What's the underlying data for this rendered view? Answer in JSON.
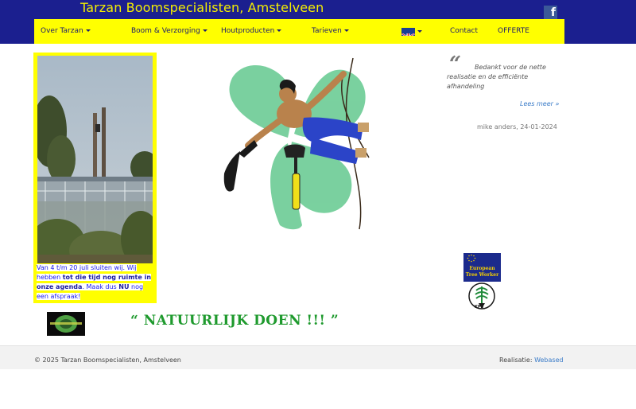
{
  "header": {
    "site_title": "Tarzan Boomspecialisten, Amstelveen",
    "background_color": "#1b1f8f",
    "title_color": "#f4ee00"
  },
  "nav": {
    "background_color": "#ffff00",
    "items": [
      {
        "label": "Over Tarzan",
        "dropdown": true
      },
      {
        "label": "Boom & Verzorging",
        "dropdown": true
      },
      {
        "label": "Houtproducten",
        "dropdown": true
      },
      {
        "label": "Tarieven",
        "dropdown": true
      },
      {
        "label": "Contact",
        "dropdown": false
      },
      {
        "label": "OFFERTE",
        "dropdown": false
      }
    ],
    "language_icon": "uk-flag-icon",
    "social_icon": "facebook-icon",
    "facebook_glyph": "f"
  },
  "notice": {
    "text_1": "Van 4 t/m 20 juli sluiten wij. Wij hebben ",
    "text_bold_1": "tot die tijd nog ruimte in onze agenda",
    "text_2": ". Maak dus ",
    "text_bold_2": "NU",
    "text_3": " nog een afspraak!"
  },
  "testimonial": {
    "quote_mark": "“",
    "text": "Bedankt voor de nette realisatie en de efficiënte afhandeling",
    "read_more": "Lees meer »",
    "author": "mike anders, 24-01-2024"
  },
  "logos": {
    "etw_text": "European Tree Worker",
    "kpb_text": "KPB"
  },
  "slogan": "“ NATUURLIJK DOEN !!! ”",
  "footer": {
    "copyright": "© 2025 Tarzan Boomspecialisten, Amstelveen",
    "realisatie_label": "Realisatie: ",
    "realisatie_link": "Webased"
  }
}
